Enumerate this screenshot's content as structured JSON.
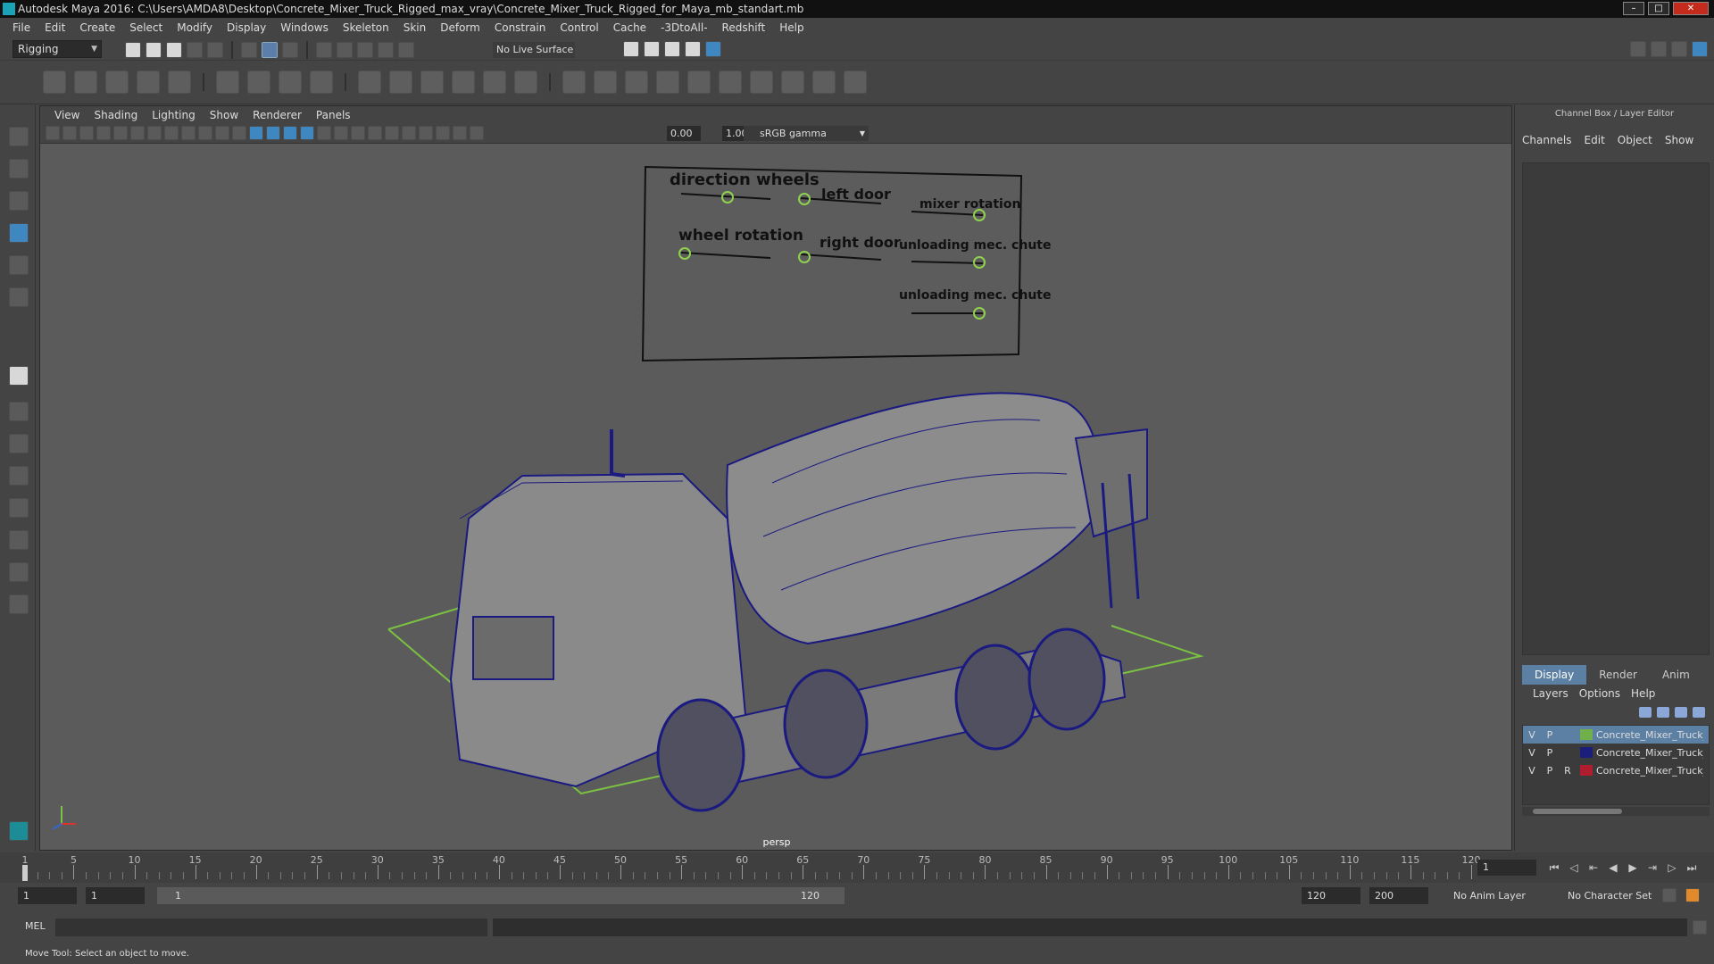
{
  "window": {
    "title": "Autodesk Maya 2016: C:\\Users\\AMDA8\\Desktop\\Concrete_Mixer_Truck_Rigged_max_vray\\Concrete_Mixer_Truck_Rigged_for_Maya_mb_standart.mb"
  },
  "menubar": [
    "File",
    "Edit",
    "Create",
    "Select",
    "Modify",
    "Display",
    "Windows",
    "Skeleton",
    "Skin",
    "Deform",
    "Constrain",
    "Control",
    "Cache",
    "-3DtoAll-",
    "Redshift",
    "Help"
  ],
  "shelf": {
    "mode": "Rigging",
    "live_surface": "No Live Surface"
  },
  "viewport": {
    "menus": [
      "View",
      "Shading",
      "Lighting",
      "Show",
      "Renderer",
      "Panels"
    ],
    "exposure": "0.00",
    "gamma": "1.00",
    "color_space": "sRGB gamma",
    "camera": "persp"
  },
  "control_board": {
    "labels": [
      "direction wheels",
      "left door",
      "mixer rotation",
      "wheel rotation",
      "right door",
      "unloading mec. chute",
      "unloading mec. chute"
    ]
  },
  "right_panel": {
    "title": "Channel Box / Layer Editor",
    "tabs": [
      "Channels",
      "Edit",
      "Object",
      "Show"
    ],
    "layer_tabs": [
      "Display",
      "Render",
      "Anim"
    ],
    "layer_menu": [
      "Layers",
      "Options",
      "Help"
    ],
    "layers": [
      {
        "v": "V",
        "p": "P",
        "r": "",
        "name": "Concrete_Mixer_Truck_",
        "color": "#6fb04a"
      },
      {
        "v": "V",
        "p": "P",
        "r": "",
        "name": "Concrete_Mixer_Truck_",
        "color": "#1b1e7a"
      },
      {
        "v": "V",
        "p": "P",
        "r": "R",
        "name": "Concrete_Mixer_Truck_",
        "color": "#b01d2f"
      }
    ]
  },
  "timeline": {
    "labels": [
      "1",
      "5",
      "10",
      "15",
      "20",
      "25",
      "30",
      "35",
      "40",
      "45",
      "50",
      "55",
      "60",
      "65",
      "70",
      "75",
      "80",
      "85",
      "90",
      "95",
      "100",
      "105",
      "110",
      "115",
      "120"
    ],
    "current_frame": "1"
  },
  "range": {
    "start": "1",
    "playback_start": "1",
    "range_low": "1",
    "range_high": "120",
    "playback_end": "120",
    "end": "200",
    "anim_layer": "No Anim Layer",
    "char_set": "No Character Set"
  },
  "command": {
    "lang": "MEL"
  },
  "status": {
    "text": "Move Tool: Select an object to move."
  }
}
